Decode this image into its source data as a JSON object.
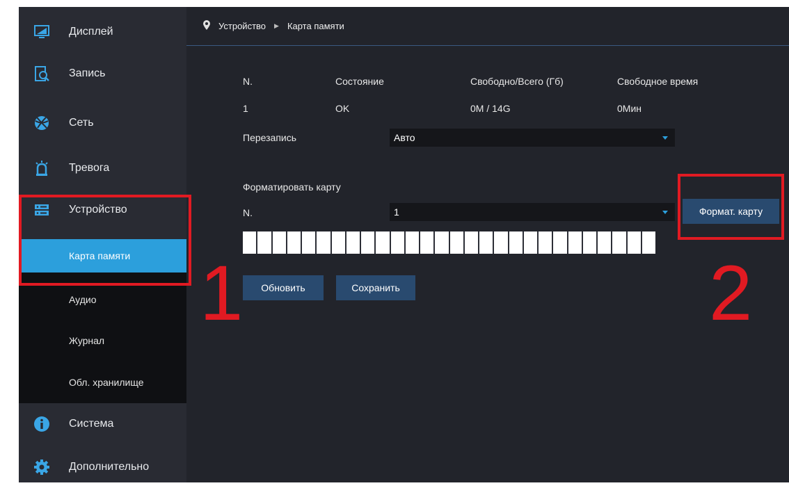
{
  "sidebar": {
    "items": [
      {
        "label": "Дисплей",
        "icon": "display-icon"
      },
      {
        "label": "Запись",
        "icon": "record-icon"
      },
      {
        "label": "Сеть",
        "icon": "network-icon"
      },
      {
        "label": "Тревога",
        "icon": "alarm-icon"
      },
      {
        "label": "Устройство",
        "icon": "device-icon"
      },
      {
        "label": "Система",
        "icon": "info-icon"
      },
      {
        "label": "Дополнительно",
        "icon": "gear-icon"
      }
    ],
    "subitems": [
      {
        "label": "Карта памяти",
        "active": true
      },
      {
        "label": "Аудио"
      },
      {
        "label": "Журнал"
      },
      {
        "label": "Обл. хранилище"
      }
    ]
  },
  "breadcrumb": {
    "parent": "Устройство",
    "current": "Карта памяти"
  },
  "table": {
    "headers": [
      "N.",
      "Состояние",
      "Свободно/Всего (Гб)",
      "Свободное время"
    ],
    "row": [
      "1",
      "OK",
      "0M / 14G",
      "0Мин"
    ]
  },
  "overwrite": {
    "label": "Перезапись",
    "value": "Авто"
  },
  "format": {
    "section_title": "Форматировать карту",
    "n_label": "N.",
    "n_value": "1",
    "button_label": "Формат. карту",
    "progress_fraction": 0
  },
  "actions": {
    "refresh_label": "Обновить",
    "save_label": "Сохранить"
  },
  "annotations": {
    "label1": "1",
    "label2": "2"
  },
  "colors": {
    "accent": "#2c9fdc",
    "button": "#294a6f",
    "annotation": "#e11a22",
    "background": "#22242b"
  }
}
